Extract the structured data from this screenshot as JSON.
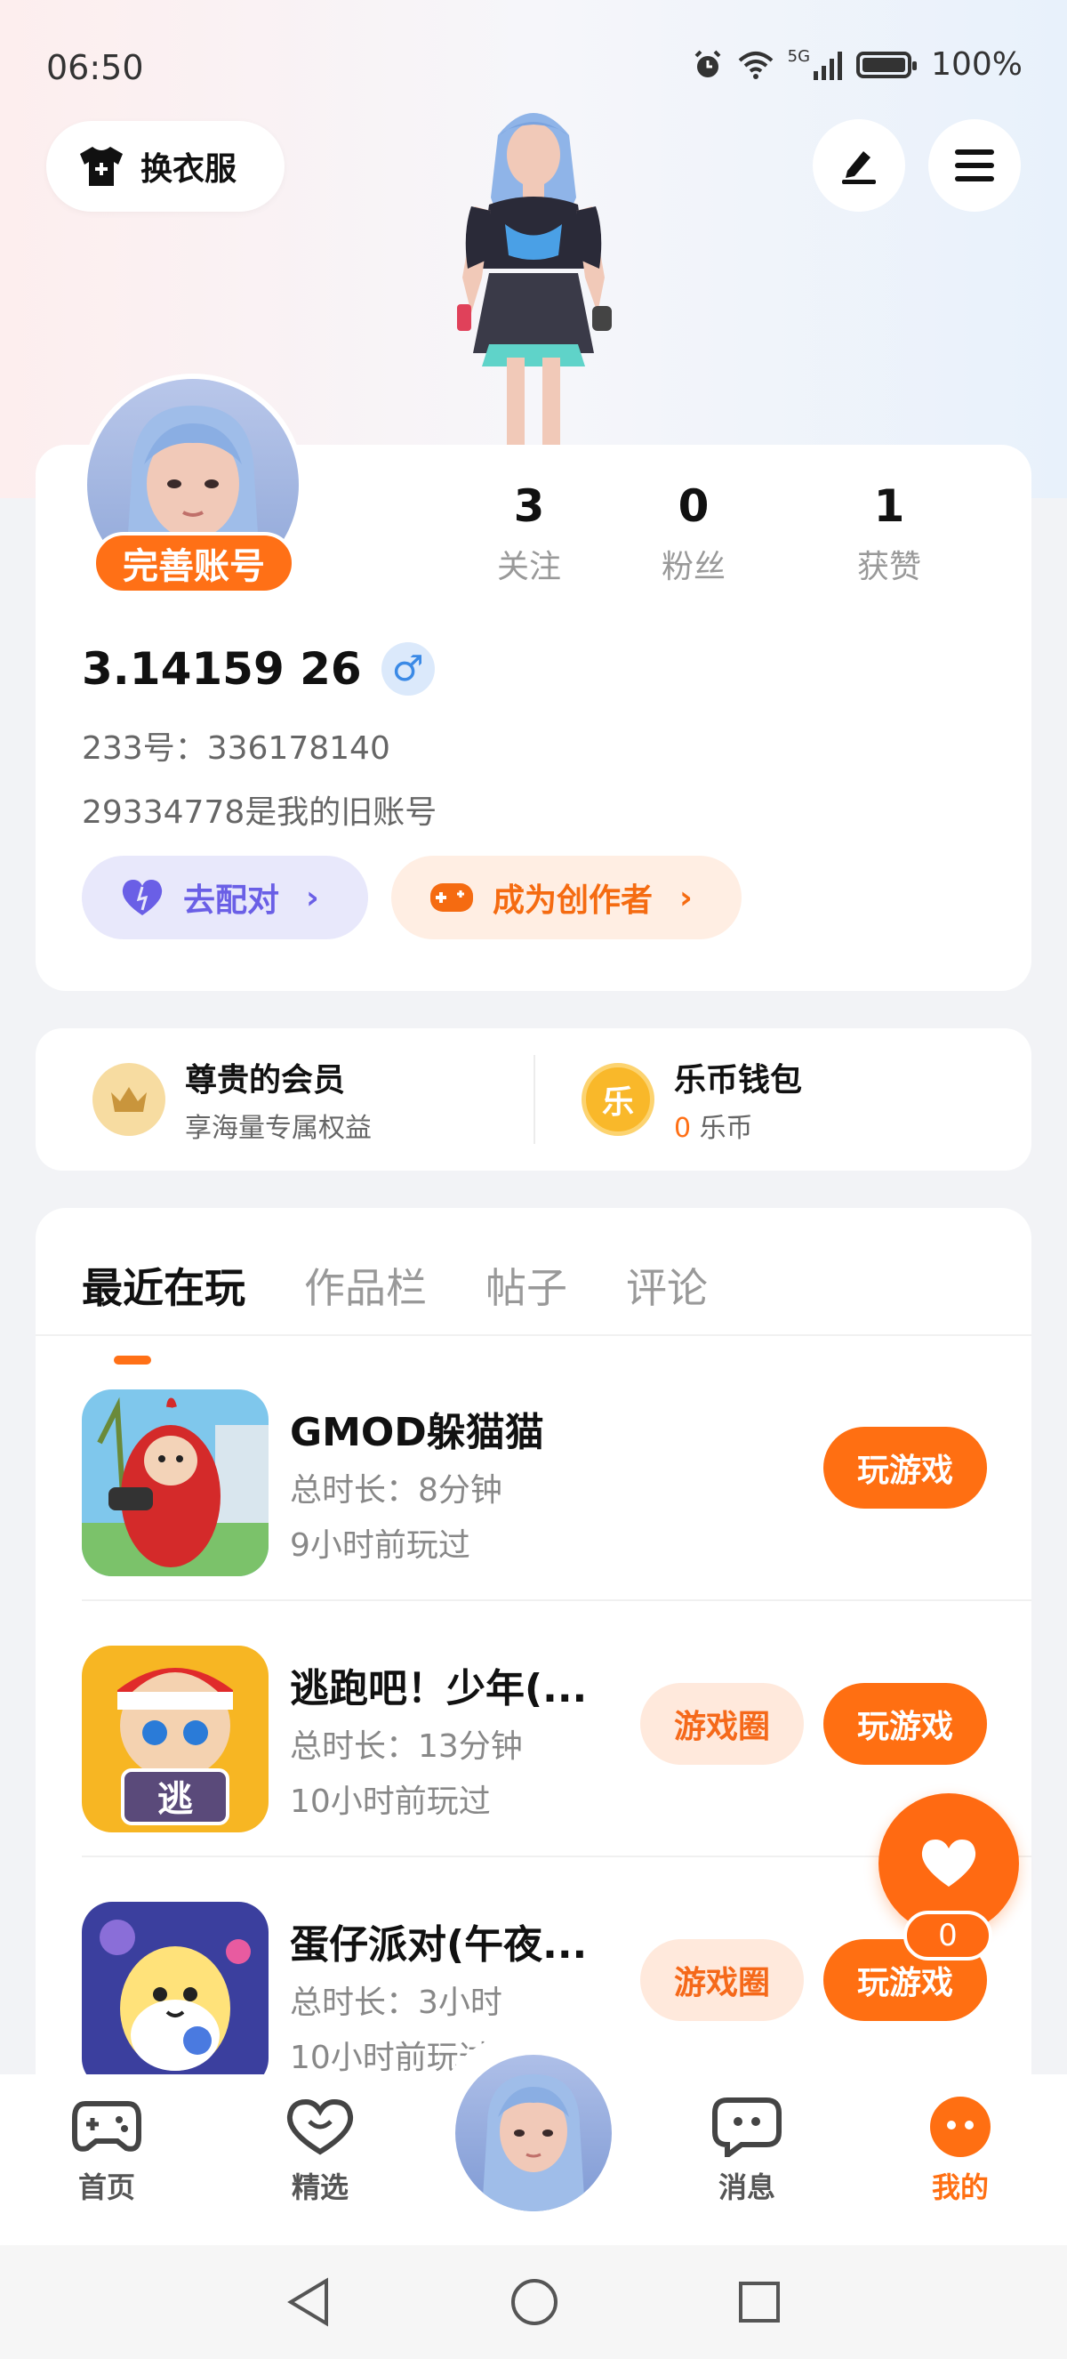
{
  "status_bar": {
    "time": "06:50",
    "network": "5G",
    "battery": "100%",
    "icons": [
      "alarm-icon",
      "wifi-icon",
      "signal-icon",
      "battery-icon"
    ]
  },
  "header": {
    "wardrobe_label": "换衣服",
    "edit_icon": "edit-icon",
    "menu_icon": "menu-icon"
  },
  "profile": {
    "complete_label": "完善账号",
    "stats": [
      {
        "num": "3",
        "label": "关注"
      },
      {
        "num": "0",
        "label": "粉丝"
      },
      {
        "num": "1",
        "label": "获赞"
      }
    ],
    "username": "3.14159 26",
    "gender_symbol": "♂",
    "uid_line": "233号：336178140",
    "old_account_line": "29334778是我的旧账号",
    "match_label": "去配对",
    "creator_label": "成为创作者"
  },
  "member": {
    "vip_title": "尊贵的会员",
    "vip_sub": "享海量专属权益",
    "wallet_title": "乐币钱包",
    "wallet_amount": "0",
    "wallet_unit": "乐币",
    "coin_glyph": "乐"
  },
  "tabs": [
    "最近在玩",
    "作品栏",
    "帖子",
    "评论"
  ],
  "games": [
    {
      "name": "GMOD躲猫猫",
      "duration": "总时长：8分钟",
      "last_played": "9小时前玩过",
      "circle_label": "",
      "play_label": "玩游戏"
    },
    {
      "name": "逃跑吧！少年(...",
      "duration": "总时长：13分钟",
      "last_played": "10小时前玩过",
      "circle_label": "游戏圈",
      "play_label": "玩游戏",
      "icon_text": "逃"
    },
    {
      "name": "蛋仔派对(午夜...",
      "duration": "总时长：3小时",
      "last_played": "10小时前玩过",
      "circle_label": "游戏圈",
      "play_label": "玩游戏"
    }
  ],
  "float_like": {
    "count": "0"
  },
  "bottom_nav": [
    {
      "label": "首页",
      "icon": "gamepad-icon"
    },
    {
      "label": "精选",
      "icon": "heart-face-icon"
    },
    {
      "label": "消息",
      "icon": "chat-icon"
    },
    {
      "label": "我的",
      "icon": "profile-face-icon"
    }
  ],
  "colors": {
    "accent": "#ff6f12",
    "match": "#6a5fe6",
    "gender": "#3b8ae6"
  }
}
